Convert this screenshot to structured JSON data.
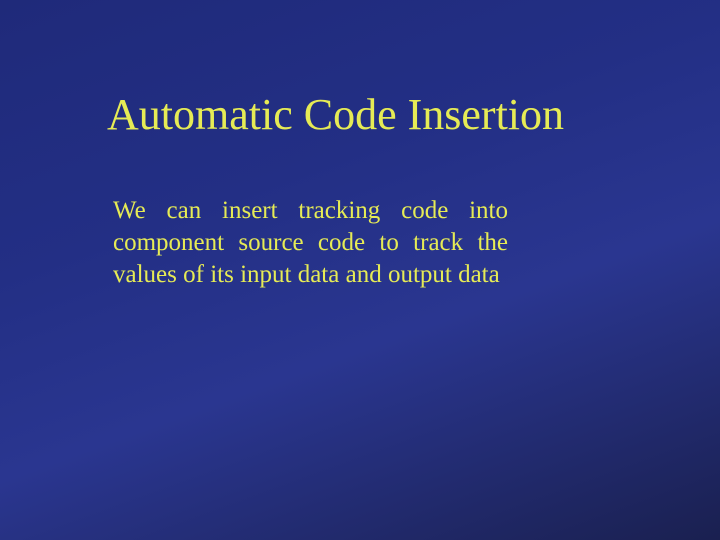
{
  "slide": {
    "title": "Automatic Code Insertion",
    "body": "We can insert tracking code into component source code to track the values of its input data and output data"
  }
}
